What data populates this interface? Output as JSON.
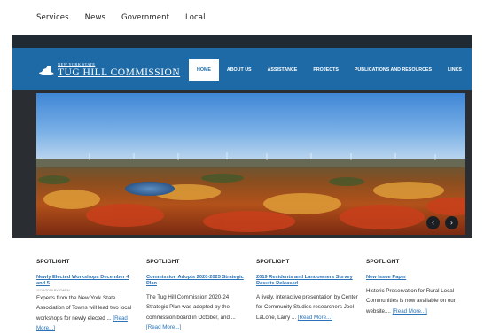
{
  "topnav": [
    "Services",
    "News",
    "Government",
    "Local"
  ],
  "logo": {
    "small": "NEW YORK STATE",
    "big": "TUG HILL COMMISSION"
  },
  "mainnav": [
    {
      "label": "HOME",
      "active": true
    },
    {
      "label": "ABOUT US",
      "active": false
    },
    {
      "label": "ASSISTANCE",
      "active": false
    },
    {
      "label": "PROJECTS",
      "active": false
    },
    {
      "label": "PUBLICATIONS AND RESOURCES",
      "active": false
    },
    {
      "label": "LINKS",
      "active": false
    }
  ],
  "slider": {
    "prev_icon": "chevron-left-icon",
    "next_icon": "chevron-right-icon",
    "prev_glyph": "‹",
    "next_glyph": "›"
  },
  "spotlights": [
    {
      "heading": "SPOTLIGHT",
      "title": "Newly Elected Workshops December 4 and 5",
      "meta": "11/19/2019 BY GWEN",
      "body": "Experts from the New York State Association of Towns will lead two local workshops for newly elected ...",
      "more": "[Read More...]"
    },
    {
      "heading": "SPOTLIGHT",
      "title": "Commission Adopts 2020-2025 Strategic Plan",
      "meta": "",
      "body": "The Tug Hill Commission 2020-24 Strategic Plan was adopted by the commission board in October, and ...",
      "more": "[Read More...]"
    },
    {
      "heading": "SPOTLIGHT",
      "title": "2019 Residents and Landowners Survey Results Released",
      "meta": "",
      "body": "A lively, interactive presentation by Center for Community Studies researchers Joel LaLone, Larry ...",
      "more": "[Read More...]"
    },
    {
      "heading": "SPOTLIGHT",
      "title": "New Issue Paper",
      "meta": "",
      "body": "Historic Preservation for Rural Local Communities is now available on our website.... ",
      "more": "[Read More...]"
    }
  ]
}
